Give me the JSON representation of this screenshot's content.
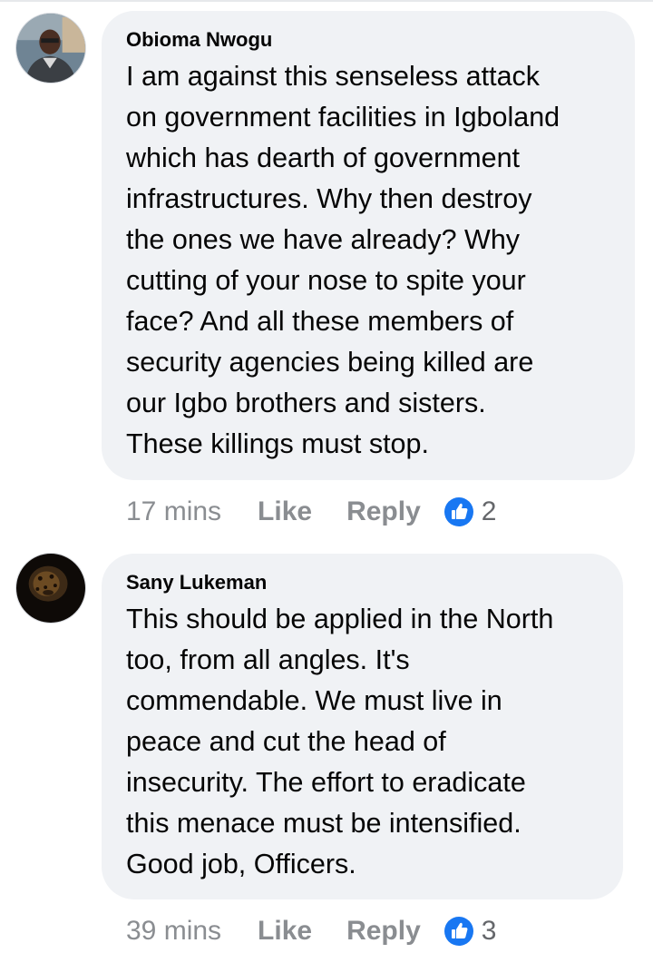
{
  "comments": [
    {
      "author": "Obioma Nwogu",
      "text": "I am against this senseless attack\non government facilities in Igboland\nwhich has dearth of government\ninfrastructures. Why then destroy\nthe ones we have already? Why\ncutting of your nose to spite your\nface?  And all these members of\nsecurity agencies being killed are\nour Igbo brothers and sisters.\nThese killings must stop.",
      "time": "17 mins",
      "like_label": "Like",
      "reply_label": "Reply",
      "reaction_count": "2",
      "reaction_icon": "thumbs-up-icon"
    },
    {
      "author": "Sany Lukeman",
      "text": "This should be applied in the North\ntoo, from all angles. It's\ncommendable. We must live in\npeace and cut the head of\ninsecurity. The effort to eradicate\nthis menace must be intensified.\nGood job, Officers.",
      "time": "39 mins",
      "like_label": "Like",
      "reply_label": "Reply",
      "reaction_count": "3",
      "reaction_icon": "thumbs-up-icon"
    }
  ],
  "colors": {
    "bubble": "#f0f2f5",
    "meta_text": "#8a8d91",
    "like_blue": "#1877f2"
  }
}
